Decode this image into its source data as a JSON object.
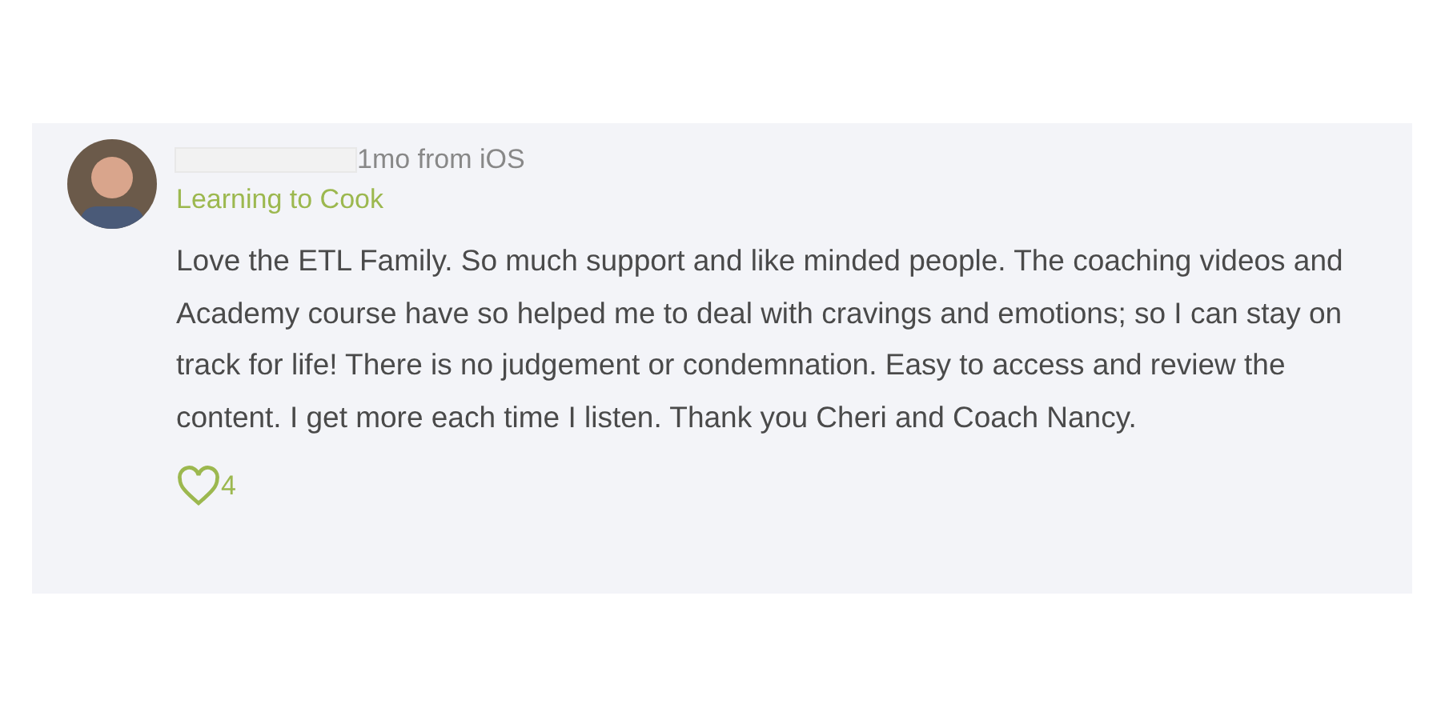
{
  "comment": {
    "meta": "1mo from iOS",
    "group": "Learning to Cook",
    "body": "Love the ETL Family. So much support and like minded people. The coaching videos and Academy course have so helped me to deal with cravings and emotions; so I can stay on track for life! There is no judgement or condemnation. Easy to access and review the content. I get more each time I listen. Thank you Cheri and Coach Nancy.",
    "likes": "4",
    "liked": false
  }
}
